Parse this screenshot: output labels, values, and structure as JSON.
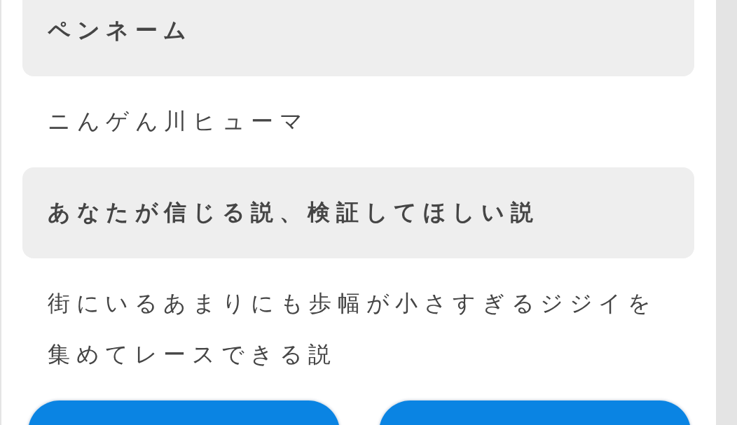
{
  "form": {
    "sections": [
      {
        "heading": "ペンネーム",
        "value": "ニんゲん川ヒューマ"
      },
      {
        "heading": "あなたが信じる説、検証してほしい説",
        "value": "街にいるあまりにも歩幅が小さすぎるジジイを集めてレースできる説"
      }
    ]
  }
}
